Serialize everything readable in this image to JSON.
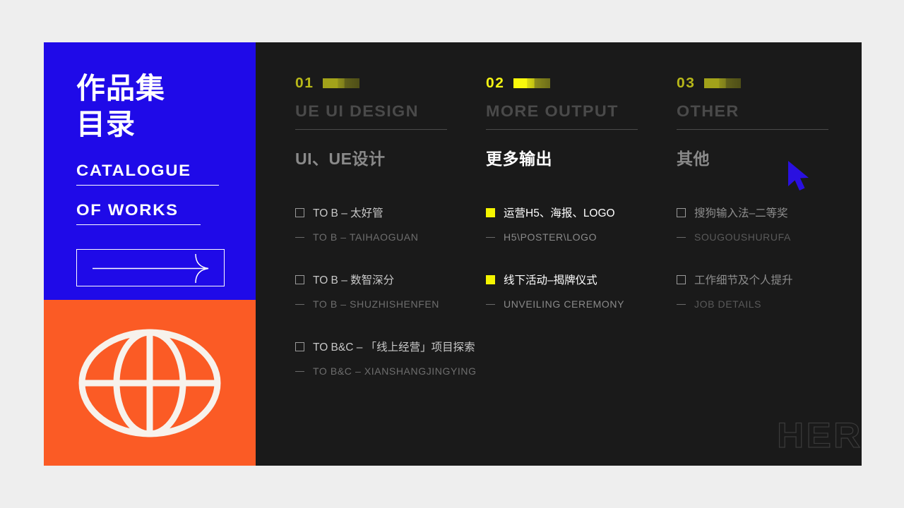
{
  "cover": {
    "title_line1": "作品集",
    "title_line2": "目录",
    "en_line1": "CATALOGUE",
    "en_line2": "OF WORKS",
    "arrow_button_label": "next-arrow",
    "globe_icon": "globe-icon",
    "colors": {
      "blue": "#1f0ae8",
      "orange": "#fb5b25"
    }
  },
  "footer": {
    "outline_text": "HERE IS MY RES"
  },
  "cursor": {
    "color": "#2a10e0"
  },
  "theme": {
    "background": "#eeeeee",
    "panel": "#1a1a1a",
    "accent_yellow": "#f5f500",
    "accent_olive": "#b8b819"
  },
  "columns": [
    {
      "number": "01",
      "en_title": "UE UI DESIGN",
      "cn_title": "UI、UE设计",
      "active": false,
      "items": [
        {
          "marker": "hollow",
          "main": "TO B – 太好管",
          "sub": "TO B – TAIHAOGUAN"
        },
        {
          "marker": "hollow",
          "main": "TO B – 数智深分",
          "sub": "TO B – SHUZHISHENFEN"
        },
        {
          "marker": "hollow",
          "main": "TO B&C – 「线上经营」项目探索",
          "sub": "TO B&C – XIANSHANGJINGYING"
        }
      ]
    },
    {
      "number": "02",
      "en_title": "MORE OUTPUT",
      "cn_title": "更多输出",
      "active": true,
      "items": [
        {
          "marker": "filled",
          "main": "运营H5、海报、LOGO",
          "sub": "H5\\POSTER\\LOGO"
        },
        {
          "marker": "filled",
          "main": "线下活动–揭牌仪式",
          "sub": "UNVEILING CEREMONY"
        }
      ]
    },
    {
      "number": "03",
      "en_title": "OTHER",
      "cn_title": "其他",
      "active": false,
      "items": [
        {
          "marker": "hollow",
          "main": "搜狗输入法–二等奖",
          "sub": "SOUGOUSHURUFA"
        },
        {
          "marker": "hollow",
          "main": "工作细节及个人提升",
          "sub": "JOB DETAILS"
        }
      ]
    }
  ]
}
